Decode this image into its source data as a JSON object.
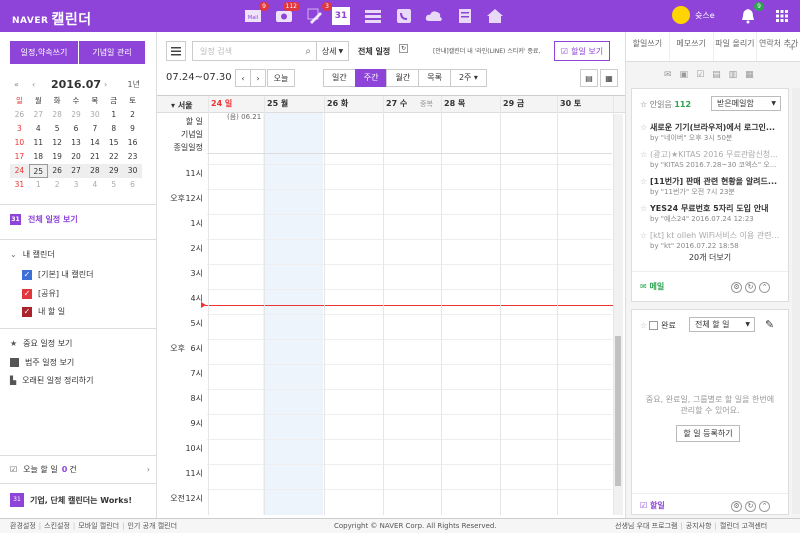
{
  "topbar": {
    "brand": "NAVER",
    "app": "캘린더",
    "icons": [
      {
        "name": "mail-icon",
        "badge": "9"
      },
      {
        "name": "cafe-icon",
        "badge": "112"
      },
      {
        "name": "blog-icon",
        "badge": "3"
      },
      {
        "name": "calendar-icon",
        "label": "31"
      },
      {
        "name": "list-icon"
      },
      {
        "name": "contacts-icon"
      },
      {
        "name": "cloud-icon"
      },
      {
        "name": "memo-icon"
      },
      {
        "name": "home-icon"
      }
    ],
    "user": "슛스e",
    "notify_badge": "9"
  },
  "sidebar": {
    "new_event": "일정,약속쓰기",
    "anniversary": "기념일 관리",
    "mini_cal": {
      "month": "2016.07",
      "year_label": "1년",
      "weekdays": [
        "일",
        "월",
        "화",
        "수",
        "목",
        "금",
        "토"
      ],
      "weeks": [
        [
          "26",
          "27",
          "28",
          "29",
          "30",
          "1",
          "2"
        ],
        [
          "3",
          "4",
          "5",
          "6",
          "7",
          "8",
          "9"
        ],
        [
          "10",
          "11",
          "12",
          "13",
          "14",
          "15",
          "16"
        ],
        [
          "17",
          "18",
          "19",
          "20",
          "21",
          "22",
          "23"
        ],
        [
          "24",
          "25",
          "26",
          "27",
          "28",
          "29",
          "30"
        ],
        [
          "31",
          "1",
          "2",
          "3",
          "4",
          "5",
          "6"
        ]
      ]
    },
    "all_events": "전체 일정 보기",
    "my_calendars": "내 캘린더",
    "calendars": [
      {
        "label": "[기본] 내 캘린더",
        "color": "#3c6fd8"
      },
      {
        "label": "[공유]",
        "color": "#e0383e"
      },
      {
        "label": "내 할 일",
        "color": "#a8232b"
      }
    ],
    "important": "중요 일정 보기",
    "category": "범주 일정 보기",
    "cleanup": "오래된 일정 정리하기",
    "todo_today": "오늘 할 일",
    "todo_count": "0",
    "todo_unit": "건",
    "works": "기업, 단체 캘린더는 Works!"
  },
  "main": {
    "search_placeholder": "일정 검색",
    "detail": "상세",
    "all_events": "전체 일정",
    "notice": "[안내]캘린더 내 '라인(LINE) 스티커' 종료,",
    "todo_view": "할일 보기",
    "range": "07.24~07.30",
    "today": "오늘",
    "views": [
      "일간",
      "주간",
      "월간",
      "목록",
      "2주"
    ],
    "active_view": "주간",
    "seoul": "서울",
    "days": [
      {
        "label": "24 일",
        "sub": "(음) 06.21"
      },
      {
        "label": "25 월"
      },
      {
        "label": "26 화"
      },
      {
        "label": "27 수",
        "extra": "중복"
      },
      {
        "label": "28 목"
      },
      {
        "label": "29 금"
      },
      {
        "label": "30 토"
      }
    ],
    "row_labels": [
      "할 일",
      "기념일",
      "종일일정"
    ],
    "hours": [
      {
        "ampm": "",
        "h": "11시"
      },
      {
        "ampm": "오후",
        "h": "12시"
      },
      {
        "ampm": "",
        "h": "1시"
      },
      {
        "ampm": "",
        "h": "2시"
      },
      {
        "ampm": "",
        "h": "3시"
      },
      {
        "ampm": "",
        "h": "4시"
      },
      {
        "ampm": "",
        "h": "5시"
      },
      {
        "ampm": "오후",
        "h": "6시"
      },
      {
        "ampm": "",
        "h": "7시"
      },
      {
        "ampm": "",
        "h": "8시"
      },
      {
        "ampm": "",
        "h": "9시"
      },
      {
        "ampm": "",
        "h": "10시"
      },
      {
        "ampm": "",
        "h": "11시"
      },
      {
        "ampm": "오전",
        "h": "12시"
      }
    ]
  },
  "right": {
    "tabs": [
      "할일쓰기",
      "메모쓰기",
      "파일 올리기",
      "연락처 추가"
    ],
    "unread_label": "안읽음",
    "unread_count": "112",
    "inbox_select": "받은메일함",
    "mails": [
      {
        "title": "새로운 기기(브라우저)에서 로그인...",
        "by": "by \"네이버\" 오후 3시 50분",
        "dim": false
      },
      {
        "title": "(광고)★KITAS 2016 무료관람신청...",
        "by": "by \"KITAS 2016.7.28~30 코엑스\" 오...",
        "dim": true
      },
      {
        "title": "[11번가] 판매 관련 현황을 알려드...",
        "by": "by \"11번가\" 오전 7시 23분",
        "dim": false
      },
      {
        "title": "YES24 무료번호 5자리 도입 안내",
        "by": "by \"예스24\" 2016.07.24 12:23",
        "dim": false
      },
      {
        "title": "[kt] kt olleh WiFi서비스 이용 관련...",
        "by": "by \"kt\" 2016.07.22 18:58",
        "dim": true
      }
    ],
    "more": "20개 더보기",
    "mail_label": "메일",
    "done_label": "완료",
    "todo_select": "전체 할 일",
    "todo_empty": "중요, 완료일, 그룹별로 할 일을 한번에 관리할 수 있어요.",
    "todo_register": "할 일 등록하기",
    "todo_label": "할일"
  },
  "footer": {
    "left": [
      "환경설정",
      "스킨설정",
      "모바일 캘린더",
      "인기 공개 캘린더"
    ],
    "copyright": "Copyright © NAVER Corp. All Rights Reserved.",
    "right": [
      "선생님 우대 프로그램",
      "공지사항",
      "캘린더 고객센터"
    ]
  }
}
